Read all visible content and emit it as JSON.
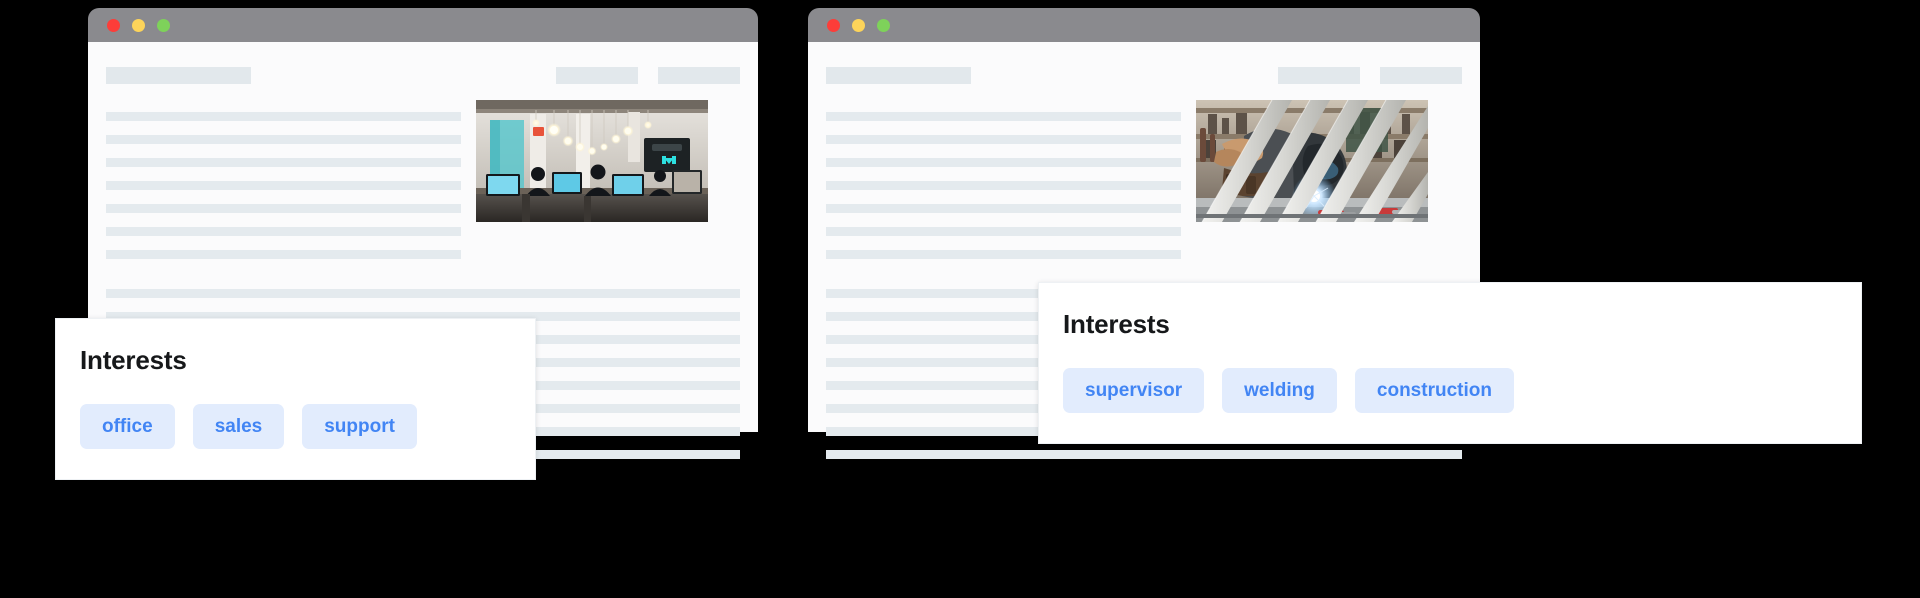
{
  "background_color": "#000000",
  "windows": [
    {
      "name": "office-browser-window",
      "titlebar_color": "#8a8a8e",
      "traffic_lights": [
        {
          "name": "close-button",
          "color": "#fc3d39"
        },
        {
          "name": "minimize-button",
          "color": "#fdd45a"
        },
        {
          "name": "maximize-button",
          "color": "#7ed25a"
        }
      ],
      "header_placeholders": {
        "left_count": 1,
        "right_count": 2
      },
      "text_line_count": 7,
      "wide_line_count": 8,
      "photo": {
        "name": "office-workspace-photo",
        "alt": "open-plan office with pendant lights and people at computers"
      }
    },
    {
      "name": "welding-browser-window",
      "titlebar_color": "#8a8a8e",
      "traffic_lights": [
        {
          "name": "close-button",
          "color": "#fc3d39"
        },
        {
          "name": "minimize-button",
          "color": "#fdd45a"
        },
        {
          "name": "maximize-button",
          "color": "#7ed25a"
        }
      ],
      "header_placeholders": {
        "left_count": 1,
        "right_count": 2
      },
      "text_line_count": 7,
      "wide_line_count": 8,
      "photo": {
        "name": "welding-workshop-photo",
        "alt": "welder working behind metal bars with bright spark"
      }
    }
  ],
  "cards": [
    {
      "name": "interests-card-office",
      "title": "Interests",
      "tags": [
        "office",
        "sales",
        "support"
      ]
    },
    {
      "name": "interests-card-trades",
      "title": "Interests",
      "tags": [
        "supervisor",
        "welding",
        "construction"
      ]
    }
  ],
  "colors": {
    "tag_background": "#e2ecfd",
    "tag_text": "#4285f4",
    "skeleton": "#e4eaee",
    "page_background": "#fbfbfc"
  }
}
